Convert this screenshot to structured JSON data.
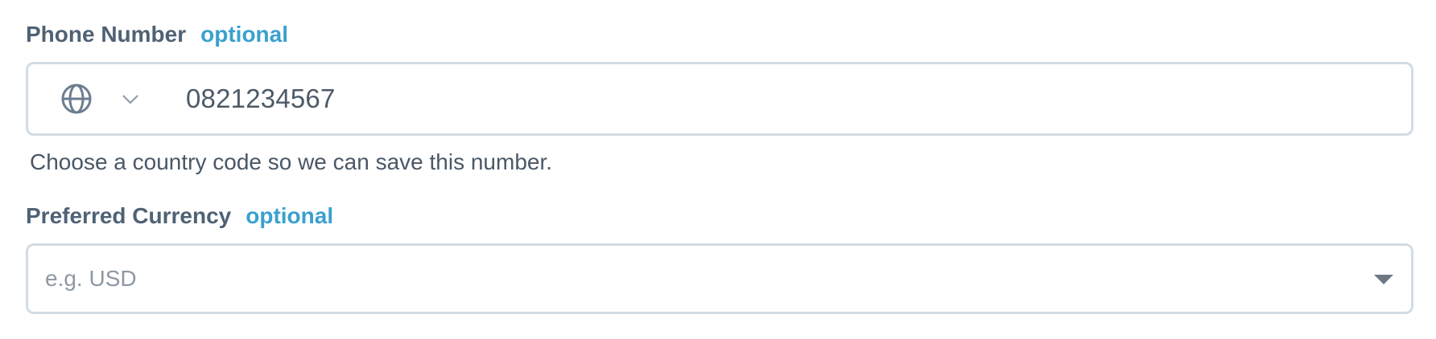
{
  "phone": {
    "label": "Phone Number",
    "optional": "optional",
    "value": "0821234567",
    "help": "Choose a country code so we can save this number.",
    "country_icon": "globe-icon",
    "dropdown_icon": "chevron-down-icon"
  },
  "currency": {
    "label": "Preferred Currency",
    "optional": "optional",
    "placeholder": "e.g. USD",
    "dropdown_icon": "caret-down-icon"
  },
  "colors": {
    "label": "#4f6275",
    "optional": "#3aa0cf",
    "border": "#d3dbe3",
    "placeholder": "#8d98a3"
  }
}
